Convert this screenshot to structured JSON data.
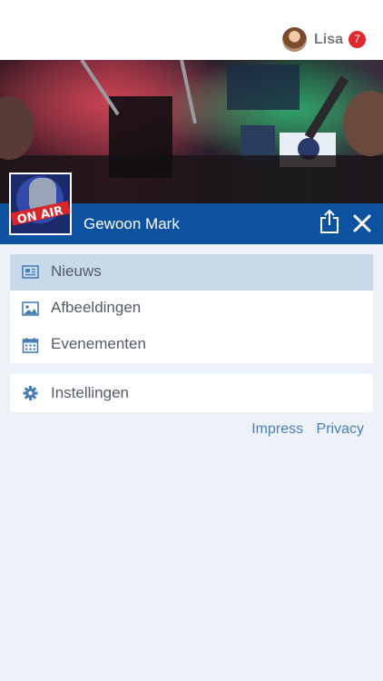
{
  "header": {
    "user_name": "Lisa",
    "notification_count": "7"
  },
  "channel": {
    "title": "Gewoon Mark"
  },
  "menu": {
    "items": [
      {
        "label": "Nieuws",
        "icon": "newspaper-icon",
        "active": true
      },
      {
        "label": "Afbeeldingen",
        "icon": "image-icon",
        "active": false
      },
      {
        "label": "Evenementen",
        "icon": "calendar-icon",
        "active": false
      }
    ],
    "settings_label": "Instellingen"
  },
  "footer": {
    "impress": "Impress",
    "privacy": "Privacy"
  },
  "colors": {
    "accent": "#0d52a0",
    "icon": "#4a7fb5",
    "active_bg": "#c8d9ea",
    "badge": "#e0282e"
  }
}
